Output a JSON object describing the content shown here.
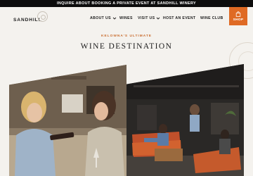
{
  "announcement": {
    "text": "INQUIRE ABOUT BOOKING A PRIVATE EVENT AT SANDHILL WINERY"
  },
  "brand": {
    "name": "SANDHILL"
  },
  "nav": {
    "items": [
      {
        "label": "ABOUT US",
        "has_dropdown": true
      },
      {
        "label": "WINES",
        "has_dropdown": false
      },
      {
        "label": "VISIT US",
        "has_dropdown": true
      },
      {
        "label": "HOST AN EVENT",
        "has_dropdown": false
      },
      {
        "label": "WINE CLUB",
        "has_dropdown": false
      }
    ],
    "shop_label": "SHOP"
  },
  "hero": {
    "eyebrow": "KELOWNA'S ULTIMATE",
    "title": "WINE DESTINATION"
  },
  "colors": {
    "accent": "#df6a24",
    "eyebrow": "#c86a2c",
    "topbar": "#0d0d0d",
    "background": "#f4f2ee"
  }
}
